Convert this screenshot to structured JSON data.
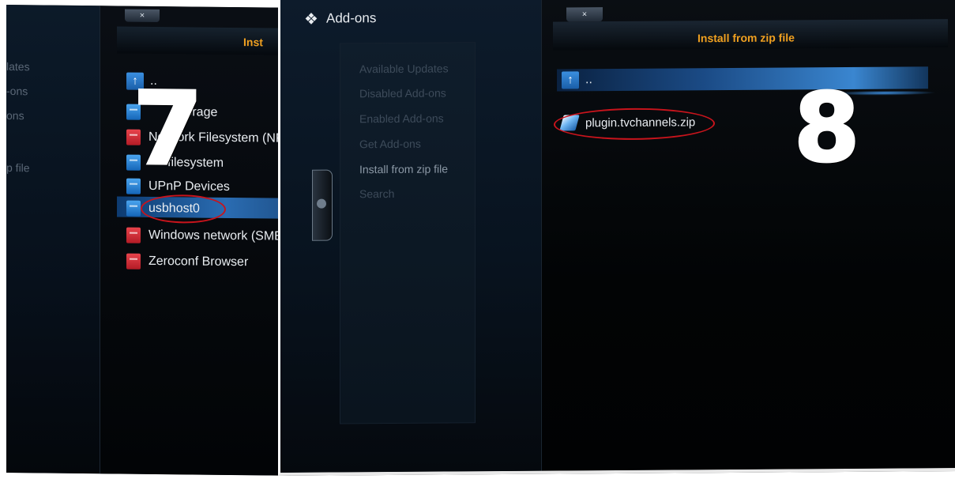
{
  "left_panel": {
    "menu_items": [
      "lates",
      "-ons",
      "ons",
      "p file"
    ],
    "close_label": "×",
    "dialog_title": "Inst",
    "up_label": "..",
    "sources": [
      {
        "label": "storage",
        "icon": "blue-drive-icon"
      },
      {
        "label": "Network Filesystem (NFS",
        "icon": "red-network-icon"
      },
      {
        "label": "filesystem",
        "icon": "blue-drive-icon"
      },
      {
        "label": "UPnP Devices",
        "icon": "blue-drive-icon"
      },
      {
        "label": "usbhost0",
        "icon": "blue-drive-icon",
        "selected": true
      },
      {
        "label": "Windows network (SMB)",
        "icon": "red-network-icon"
      },
      {
        "label": "Zeroconf Browser",
        "icon": "red-network-icon"
      }
    ],
    "step_number": "7"
  },
  "right_panel": {
    "header_title": "Add-ons",
    "side_menu": [
      "Available Updates",
      "Disabled Add-ons",
      "Enabled Add-ons",
      "Get Add-ons",
      "Install from zip file",
      "Search"
    ],
    "active_side_item": "Install from zip file",
    "close_label": "×",
    "dialog_title": "Install from zip file",
    "up_label": "..",
    "files": [
      {
        "label": "plugin.tvchannels.zip",
        "icon": "zip-file-icon"
      }
    ],
    "step_number": "8"
  },
  "colors": {
    "accent_title": "#f0a020",
    "highlight_blue": "#2a6cb2",
    "annotation_red": "#c8141c"
  }
}
